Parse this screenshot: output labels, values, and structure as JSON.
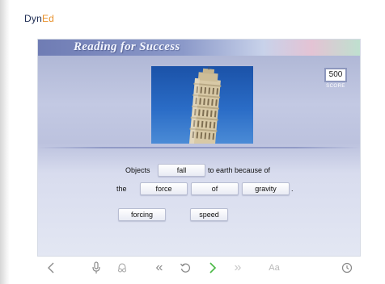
{
  "brand": {
    "logo_main": "Dyn",
    "logo_accent": "Ed"
  },
  "lesson": {
    "title": "Reading for Success",
    "score_value": "500",
    "score_label": "SCORE"
  },
  "sentence": {
    "line1_before": "Objects",
    "line1_after": "to earth because of",
    "line2_before": "the",
    "line2_after": ".",
    "filled_words": [
      "fall",
      "force",
      "of",
      "gravity"
    ]
  },
  "word_bank": [
    "forcing",
    "speed"
  ],
  "toolbar": {
    "icons": [
      "back-icon",
      "microphone-icon",
      "listen-icon",
      "rewind-icon",
      "repeat-icon",
      "next-icon",
      "fast-forward-icon",
      "text-size-icon",
      "clock-icon"
    ],
    "text_size_label": "Aa"
  },
  "colors": {
    "brand_navy": "#1f2d54",
    "brand_orange": "#e8902a",
    "next_green": "#49b844"
  }
}
